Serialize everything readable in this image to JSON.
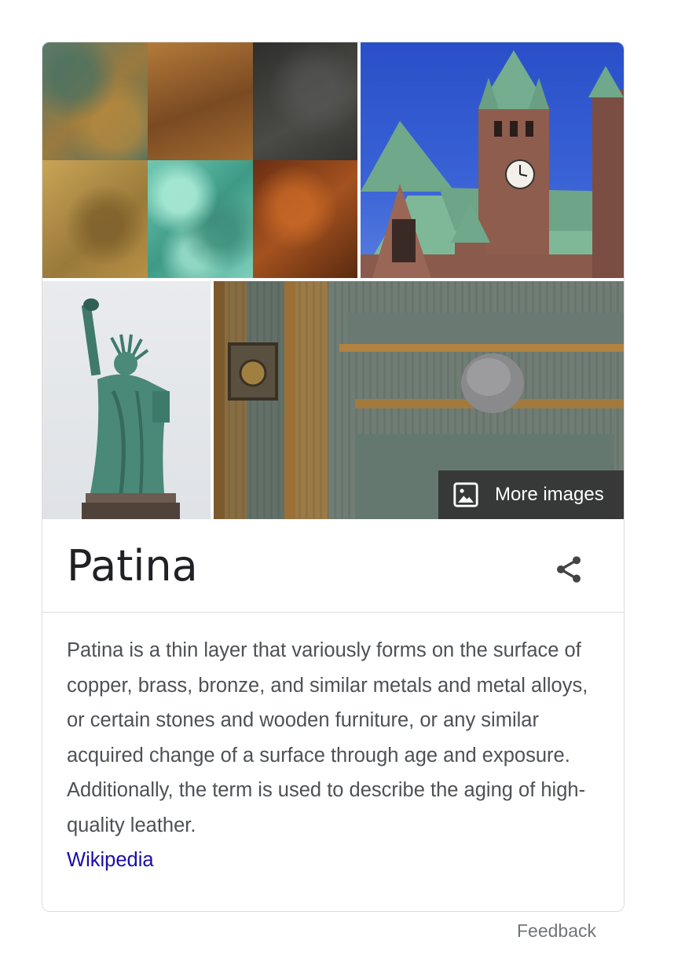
{
  "knowledge_panel": {
    "title": "Patina",
    "more_images_label": "More images",
    "description": "Patina is a thin layer that variously forms on the surface of copper, brass, bronze, and similar metals and metal alloys, or certain stones and wooden furniture, or any similar acquired change of a surface through age and exposure. Additionally, the term is used to describe the aging of high-quality leather.",
    "source_link": "Wikipedia",
    "share_icon": "share-icon",
    "images": [
      "patina-texture-swatches",
      "green-roofed-clock-tower-building",
      "statue-of-liberty",
      "weathered-wooden-door-with-knob"
    ]
  },
  "footer": {
    "feedback_label": "Feedback"
  },
  "colors": {
    "title": "#202124",
    "body_text": "#4d5156",
    "link": "#1a0dab",
    "border": "#dadce0",
    "muted": "#70757a"
  }
}
